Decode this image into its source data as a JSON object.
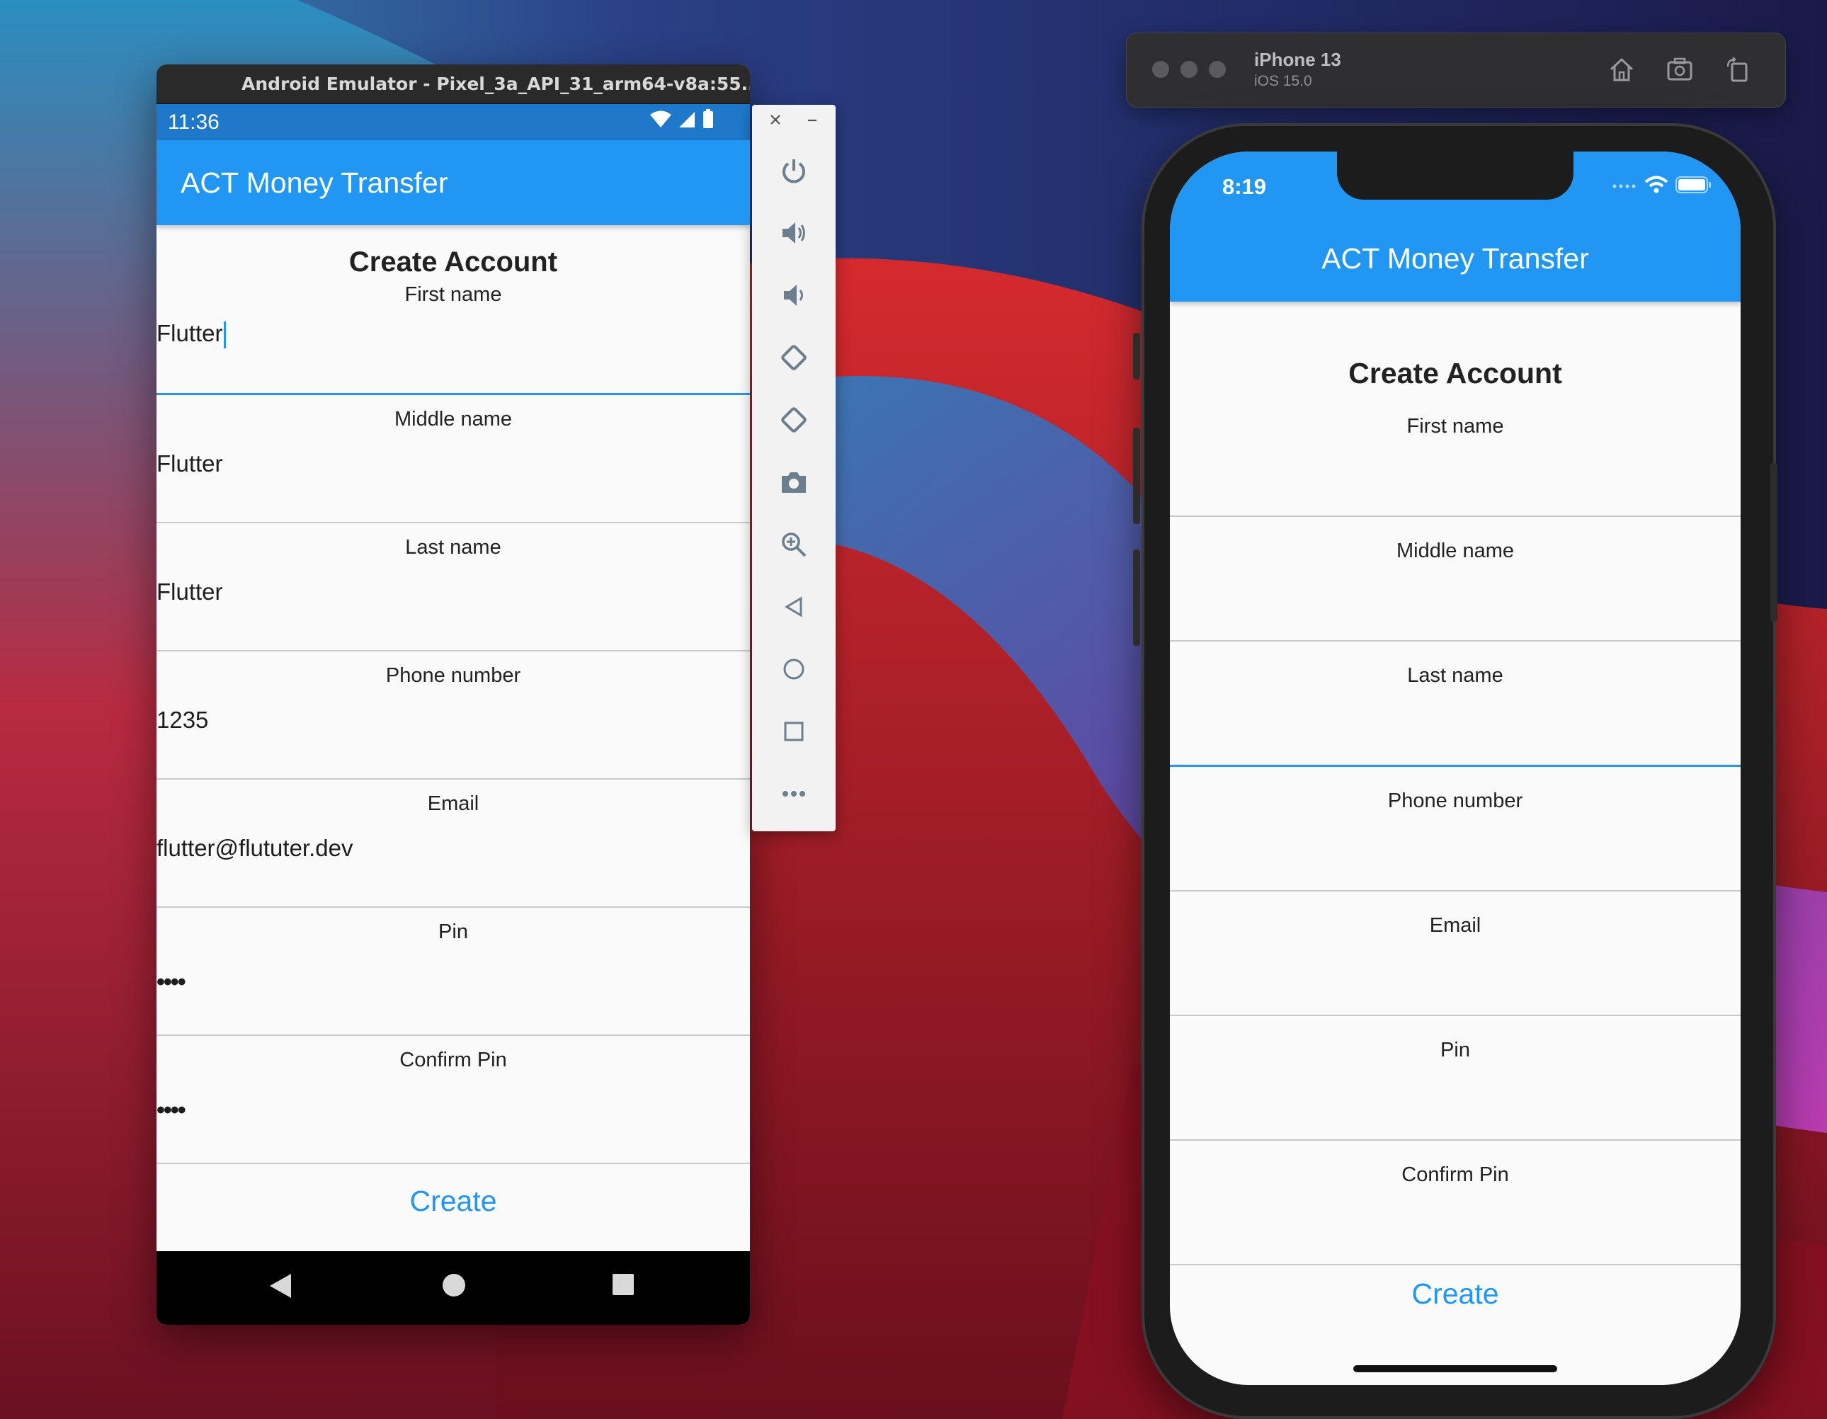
{
  "android": {
    "window_title": "Android Emulator - Pixel_3a_API_31_arm64-v8a:55...",
    "status_time": "11:36",
    "app_title": "ACT Money Transfer",
    "heading": "Create Account",
    "fields": [
      {
        "label": "First name",
        "value": "Flutter"
      },
      {
        "label": "Middle name",
        "value": "Flutter"
      },
      {
        "label": "Last name",
        "value": "Flutter"
      },
      {
        "label": "Phone number",
        "value": "1235"
      },
      {
        "label": "Email",
        "value": "flutter@flututer.dev"
      },
      {
        "label": "Pin",
        "value": "••••"
      },
      {
        "label": "Confirm Pin",
        "value": "••••"
      }
    ],
    "create_label": "Create",
    "toolbar_icons": [
      "close-icon",
      "minimize-icon",
      "power-icon",
      "volume-up-icon",
      "volume-down-icon",
      "rotate-left-icon",
      "rotate-right-icon",
      "camera-icon",
      "zoom-icon",
      "back-icon",
      "home-icon",
      "overview-icon",
      "more-icon"
    ]
  },
  "ios": {
    "device_name": "iPhone 13",
    "os_version": "iOS 15.0",
    "status_time": "8:19",
    "app_title": "ACT Money Transfer",
    "heading": "Create Account",
    "fields": [
      {
        "label": "First name"
      },
      {
        "label": "Middle name"
      },
      {
        "label": "Last name"
      },
      {
        "label": "Phone number"
      },
      {
        "label": "Email"
      },
      {
        "label": "Pin"
      },
      {
        "label": "Confirm Pin"
      }
    ],
    "create_label": "Create",
    "toolbar_icons": [
      "home-icon",
      "screenshot-icon",
      "rotate-icon"
    ]
  },
  "colors": {
    "accent": "#2196f3",
    "status_bar": "#1f78c9",
    "background": "#fafafa"
  }
}
